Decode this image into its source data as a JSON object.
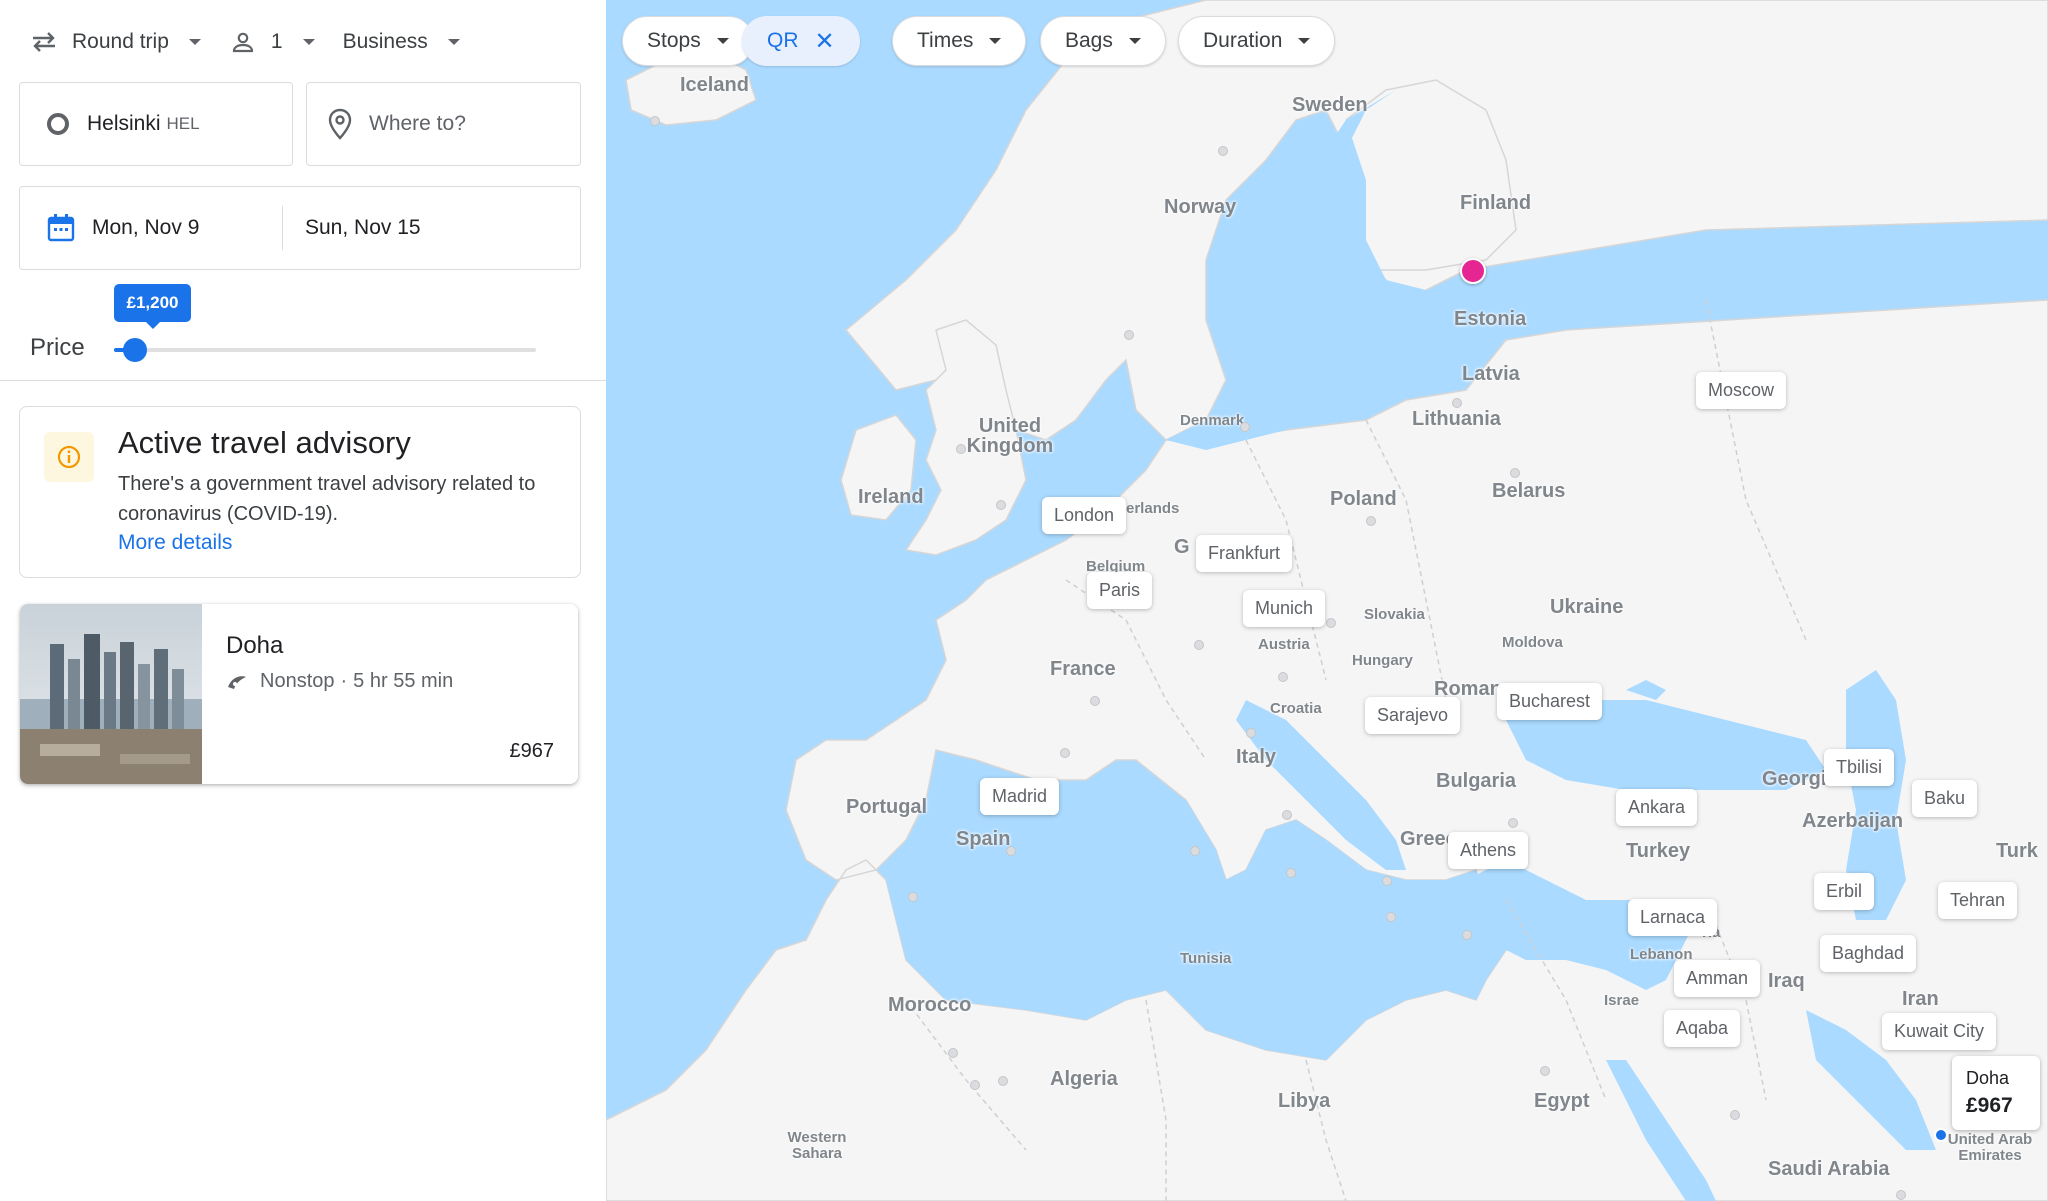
{
  "search": {
    "trip_type": "Round trip",
    "passengers": "1",
    "cabin": "Business",
    "from_city": "Helsinki",
    "from_code": "HEL",
    "to_placeholder": "Where to?",
    "depart_date": "Mon, Nov 9",
    "return_date": "Sun, Nov 15"
  },
  "price_filter": {
    "label": "Price",
    "tooltip": "£1,200",
    "level_fraction": 0.05
  },
  "advisory": {
    "title": "Active travel advisory",
    "text": "There's a government travel advisory related to coronavirus (COVID-19).",
    "link": "More details"
  },
  "result": {
    "city": "Doha",
    "stops": "Nonstop",
    "separator": "·",
    "duration": "5 hr 55 min",
    "price": "£967"
  },
  "filters": {
    "stops": "Stops",
    "airline": "QR",
    "times": "Times",
    "bags": "Bags",
    "duration": "Duration"
  },
  "map": {
    "countries": {
      "iceland": "Iceland",
      "sweden": "Sweden",
      "norway": "Norway",
      "finland": "Finland",
      "estonia": "Estonia",
      "latvia": "Latvia",
      "lithuania": "Lithuania",
      "denmark": "Denmark",
      "united_kingdom": "United Kingdom",
      "ireland": "Ireland",
      "netherlands": "erlands",
      "belgium": "Belgium",
      "germany": "G",
      "poland": "Poland",
      "belarus": "Belarus",
      "ukraine": "Ukraine",
      "slovakia": "Slovakia",
      "austria": "Austria",
      "hungary": "Hungary",
      "moldova": "Moldova",
      "romania": "Roman",
      "croatia": "Croatia",
      "france": "France",
      "italy": "Italy",
      "bulgaria": "Bulgaria",
      "portugal": "Portugal",
      "spain": "Spain",
      "greece": "Greec",
      "turkey": "Turkey",
      "georgia": "Georgi",
      "azerbaijan": "Azerbaijan",
      "turkmenistan": "Turk",
      "iraq": "Iraq",
      "iran": "Iran",
      "lebanon": "Lebanon",
      "syria": "ria",
      "israel": "Israe",
      "tunisia": "Tunisia",
      "morocco": "Morocco",
      "algeria": "Algeria",
      "libya": "Libya",
      "egypt": "Egypt",
      "western_sahara": "Western Sahara",
      "saudi_arabia": "Saudi Arabia",
      "uae": "United Arab Emirates"
    },
    "cities": {
      "moscow": "Moscow",
      "london": "London",
      "frankfurt": "Frankfurt",
      "paris": "Paris",
      "munich": "Munich",
      "sarajevo": "Sarajevo",
      "bucharest": "Bucharest",
      "madrid": "Madrid",
      "athens": "Athens",
      "ankara": "Ankara",
      "tbilisi": "Tbilisi",
      "baku": "Baku",
      "larnaca": "Larnaca",
      "erbil": "Erbil",
      "tehran": "Tehran",
      "baghdad": "Baghdad",
      "amman": "Amman",
      "aqaba": "Aqaba",
      "kuwait_city": "Kuwait City"
    },
    "destination": {
      "city": "Doha",
      "price": "£967"
    },
    "colors": {
      "water": "#aadaff",
      "land": "#f5f5f5",
      "origin_pin": "#e52592",
      "accent": "#1a73e8"
    }
  }
}
